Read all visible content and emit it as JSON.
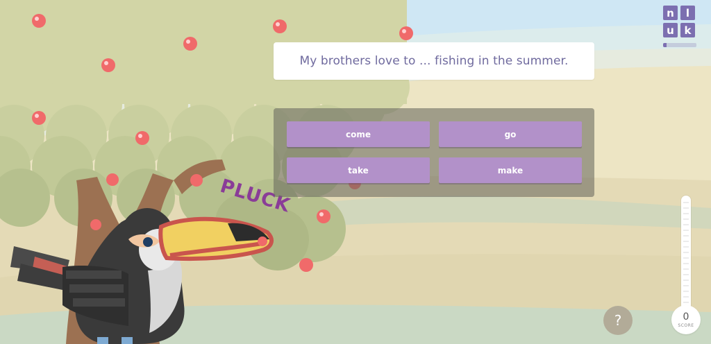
{
  "question": {
    "text": "My brothers love to ... fishing in the summer."
  },
  "answers": [
    {
      "label": "come"
    },
    {
      "label": "go"
    },
    {
      "label": "take"
    },
    {
      "label": "make"
    }
  ],
  "logo": {
    "letters": [
      "n",
      "l",
      "u",
      "k"
    ]
  },
  "effect": {
    "text": "PLUCK"
  },
  "score": {
    "value": "0",
    "label": "SCORE"
  },
  "help": {
    "label": "?"
  },
  "progress": {
    "fraction": 0.1
  },
  "colors": {
    "accent": "#7c6fb0",
    "answer_button": "#b291c9",
    "question_text": "#6f6a9e",
    "pluck_text": "#8a3c98"
  },
  "icons": [
    "help-icon",
    "toucan-character",
    "apple-tree"
  ]
}
